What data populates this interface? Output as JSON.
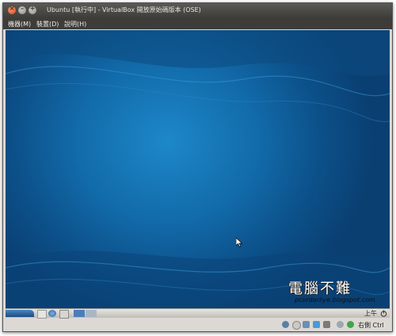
{
  "window": {
    "title": "Ubuntu [執行中] - VirtualBox 開放原始碼版本 (OSE)",
    "controls": {
      "close": "×",
      "minimize": "–",
      "maximize": "+"
    }
  },
  "menubar": {
    "items": [
      "機器(M)",
      "裝置(D)",
      "說明(H)"
    ]
  },
  "guest_panel": {
    "clock": "上午"
  },
  "status_bar": {
    "host_key": "右側 Ctrl"
  },
  "watermark": {
    "title": "電腦不難",
    "subtitle": "pcorderliye.blogspot.com"
  },
  "colors": {
    "desktop": "#126aa9",
    "titlebar": "#3d3c39",
    "close_button": "#d9471c"
  }
}
